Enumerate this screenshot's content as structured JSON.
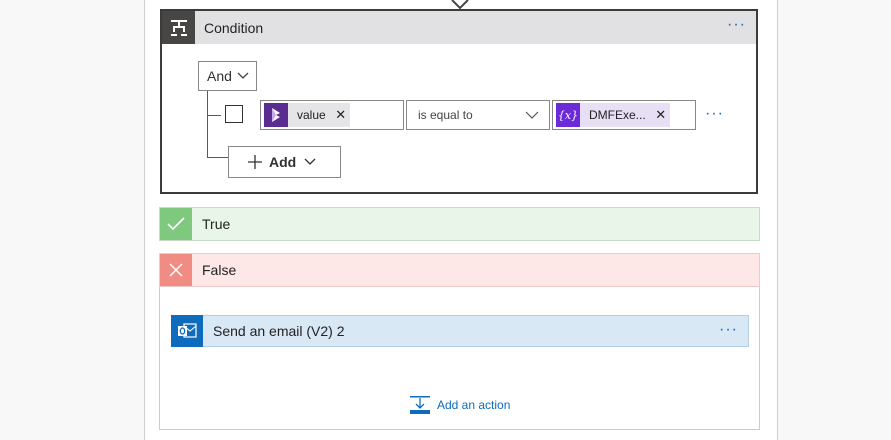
{
  "condition": {
    "title": "Condition",
    "header_icon": "condition-icon",
    "more_label": "···",
    "group_operator": "And",
    "row": {
      "left_token": {
        "label": "value",
        "icon": "dynamics-icon",
        "icon_color": "#5c2d91"
      },
      "operator": "is equal to",
      "right_token": {
        "label": "DMFExe...",
        "icon": "expression-variable-icon",
        "icon_color": "#6b2bd6"
      },
      "more_label": "···"
    },
    "add_label": "Add"
  },
  "branches": {
    "true_label": "True",
    "false_label": "False",
    "true_color": "#7fc97f",
    "false_color": "#f08c84"
  },
  "false_branch": {
    "action": {
      "title": "Send an email (V2) 2",
      "icon": "outlook-icon",
      "more_label": "···"
    },
    "add_action_label": "Add an action"
  },
  "colors": {
    "accent": "#0f6cbd",
    "outlook": "#0f6cbd"
  }
}
